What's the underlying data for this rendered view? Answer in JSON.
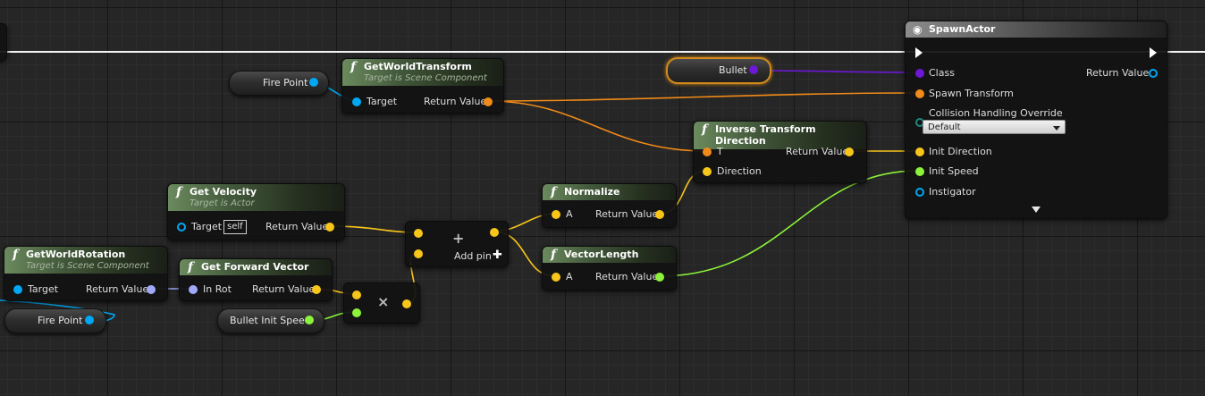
{
  "colors": {
    "exec": "#ffffff",
    "object": "#00a8f4",
    "transform": "#f08a18",
    "vector": "#f8c51a",
    "float": "#8cf33a",
    "rotator": "#9fa9f8",
    "class": "#6c18d6"
  },
  "nodes": {
    "get_world_transform": {
      "title": "GetWorldTransform",
      "subtitle": "Target is Scene Component",
      "target": "Target",
      "return": "Return Value"
    },
    "get_velocity": {
      "title": "Get Velocity",
      "subtitle": "Target is Actor",
      "target": "Target",
      "self": "self",
      "return": "Return Value"
    },
    "get_world_rotation": {
      "title": "GetWorldRotation",
      "subtitle": "Target is Scene Component",
      "target": "Target",
      "return": "Return Value"
    },
    "get_forward_vector": {
      "title": "Get Forward Vector",
      "in_rot": "In Rot",
      "return": "Return Value"
    },
    "add": {
      "symbol": "+",
      "add_pin": "Add pin"
    },
    "multiply": {
      "symbol": "×"
    },
    "normalize": {
      "title": "Normalize",
      "a": "A",
      "return": "Return Value"
    },
    "vector_length": {
      "title": "VectorLength",
      "a": "A",
      "return": "Return Value"
    },
    "inverse_transform_direction": {
      "title": "Inverse Transform Direction",
      "t": "T",
      "direction": "Direction",
      "return": "Return Value"
    },
    "spawn_actor": {
      "title": "SpawnActor",
      "class": "Class",
      "return": "Return Value",
      "spawn_transform": "Spawn Transform",
      "collision": "Collision Handling Override",
      "collision_value": "Default",
      "init_direction": "Init Direction",
      "init_speed": "Init Speed",
      "instigator": "Instigator"
    }
  },
  "variables": {
    "fire_point_top": "Fire Point",
    "fire_point_bottom": "Fire Point",
    "bullet": "Bullet",
    "bullet_init_speed": "Bullet Init Speed"
  }
}
